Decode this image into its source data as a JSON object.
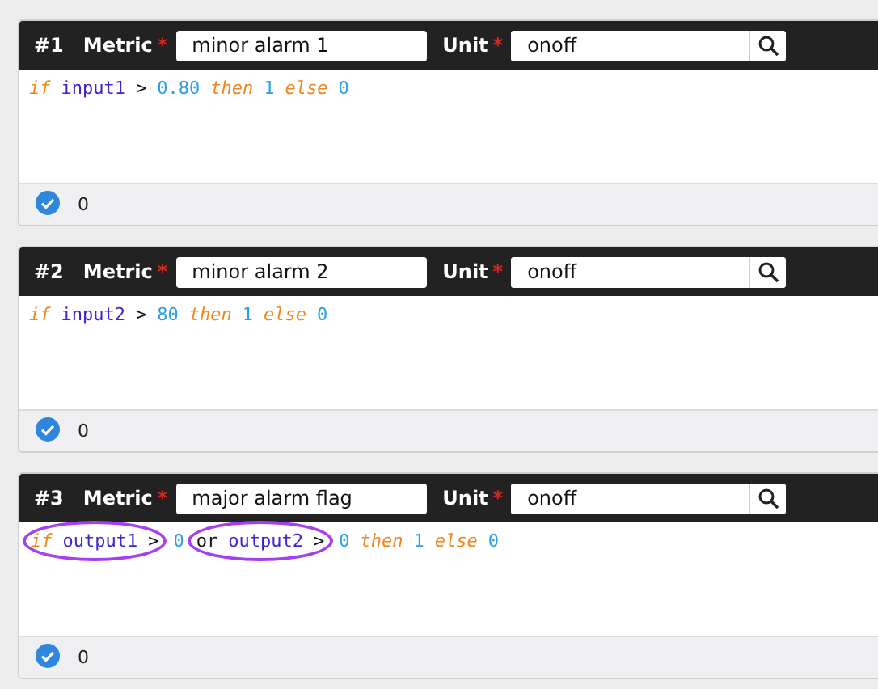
{
  "formulas": [
    {
      "number": "#1",
      "required_mark": "*",
      "metric_label": "Metric",
      "metric": "minor alarm 1",
      "unit_label": "Unit",
      "unit": "onoff",
      "code": [
        {
          "circled": false,
          "tokens": [
            {
              "kind": "keyword",
              "text": "if"
            },
            {
              "kind": "variable",
              "text": "input1"
            },
            {
              "kind": "operator",
              "text": ">"
            },
            {
              "kind": "number",
              "text": "0.80"
            },
            {
              "kind": "keyword",
              "text": "then"
            },
            {
              "kind": "number",
              "text": "1"
            },
            {
              "kind": "keyword",
              "text": "else"
            },
            {
              "kind": "number",
              "text": "0"
            }
          ]
        }
      ],
      "valid": true,
      "result": "0"
    },
    {
      "number": "#2",
      "required_mark": "*",
      "metric_label": "Metric",
      "metric": "minor alarm 2",
      "unit_label": "Unit",
      "unit": "onoff",
      "code": [
        {
          "circled": false,
          "tokens": [
            {
              "kind": "keyword",
              "text": "if"
            },
            {
              "kind": "variable",
              "text": "input2"
            },
            {
              "kind": "operator",
              "text": ">"
            },
            {
              "kind": "number",
              "text": "80"
            },
            {
              "kind": "keyword",
              "text": "then"
            },
            {
              "kind": "number",
              "text": "1"
            },
            {
              "kind": "keyword",
              "text": "else"
            },
            {
              "kind": "number",
              "text": "0"
            }
          ]
        }
      ],
      "valid": true,
      "result": "0"
    },
    {
      "number": "#3",
      "required_mark": "*",
      "metric_label": "Metric",
      "metric": "major alarm flag",
      "unit_label": "Unit",
      "unit": "onoff",
      "code": [
        {
          "circled": true,
          "tokens": [
            {
              "kind": "keyword",
              "text": "if"
            },
            {
              "kind": "variable",
              "text": "output1"
            },
            {
              "kind": "operator",
              "text": ">"
            }
          ]
        },
        {
          "circled": false,
          "tokens": [
            {
              "kind": "number",
              "text": "0"
            }
          ]
        },
        {
          "circled": true,
          "tokens": [
            {
              "kind": "operator",
              "text": "or"
            },
            {
              "kind": "variable",
              "text": "output2"
            },
            {
              "kind": "operator",
              "text": ">"
            }
          ]
        },
        {
          "circled": false,
          "tokens": [
            {
              "kind": "number",
              "text": "0"
            },
            {
              "kind": "keyword",
              "text": "then"
            },
            {
              "kind": "number",
              "text": "1"
            },
            {
              "kind": "keyword",
              "text": "else"
            },
            {
              "kind": "number",
              "text": "0"
            }
          ]
        }
      ],
      "valid": true,
      "result": "0"
    }
  ]
}
